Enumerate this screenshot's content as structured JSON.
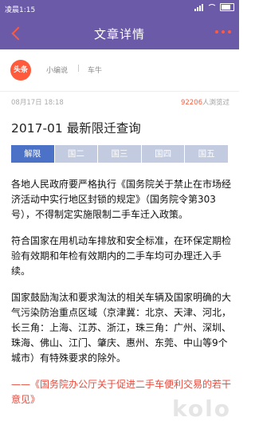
{
  "statusbar": {
    "time": "凌晨1:15"
  },
  "navbar": {
    "title": "文章详情"
  },
  "source": {
    "logo_text": "头条",
    "author": "小编说",
    "separator": "|",
    "category": "车牛"
  },
  "meta": {
    "date": "08月17日 18:18",
    "views_count": "92206",
    "views_suffix": "人浏览过"
  },
  "article": {
    "title": "2017-01 最新限迁查询",
    "tabs": [
      "解限",
      "国二",
      "国三",
      "国四",
      "国五"
    ],
    "active_tab": 0,
    "paragraphs": [
      "各地人民政府要严格执行《国务院关于禁止在市场经济活动中实行地区封锁的规定》（国务院令第303号），不得制定实施限制二手车迁入政策。",
      "符合国家在用机动车排放和安全标准，在环保定期检验有效期和年检有效期内的二手车均可办理迁入手续。",
      "国家鼓励淘汰和要求淘汰的相关车辆及国家明确的大气污染防治重点区域（京津冀：北京、天津、河北，长三角：上海、江苏、浙江，珠三角：广州、深圳、珠海、佛山、江门、肇庆、惠州、东莞、中山等9个城市）有特殊要求的除外。"
    ],
    "quote": "——《国务院办公厅关于促进二手车便利交易的若干意见》"
  },
  "watermark": "kolo",
  "colors": {
    "primary": "#6b5aa8",
    "accent": "#ff5a3c",
    "tab_active": "#4b72c6",
    "tab_inactive": "#c2cbe0"
  }
}
